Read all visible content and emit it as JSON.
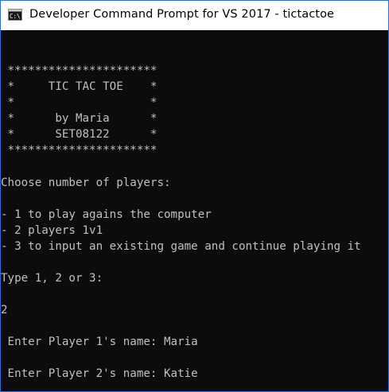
{
  "window": {
    "title": "Developer Command Prompt for VS 2017 - tictactoe",
    "icon": "command-prompt-icon"
  },
  "colors": {
    "console_background": "#0c0c0c",
    "console_text": "#c0c0c0",
    "titlebar_background": "#ffffff",
    "window_border": "#2b6fd6"
  },
  "console": {
    "banner": [
      " **********************",
      " *     TIC TAC TOE    *",
      " *                    *",
      " *      by Maria      *",
      " *      SET08122      *",
      " **********************"
    ],
    "choose_prompt": "Choose number of players:",
    "options": [
      "- 1 to play agains the computer",
      "- 2 players 1v1",
      "- 3 to input an existing game and continue playing it"
    ],
    "type_prompt": "Type 1, 2 or 3:",
    "choice_input": "2",
    "player1_prompt": " Enter Player 1's name: Maria",
    "player2_prompt": " Enter Player 2's name: Katie"
  }
}
